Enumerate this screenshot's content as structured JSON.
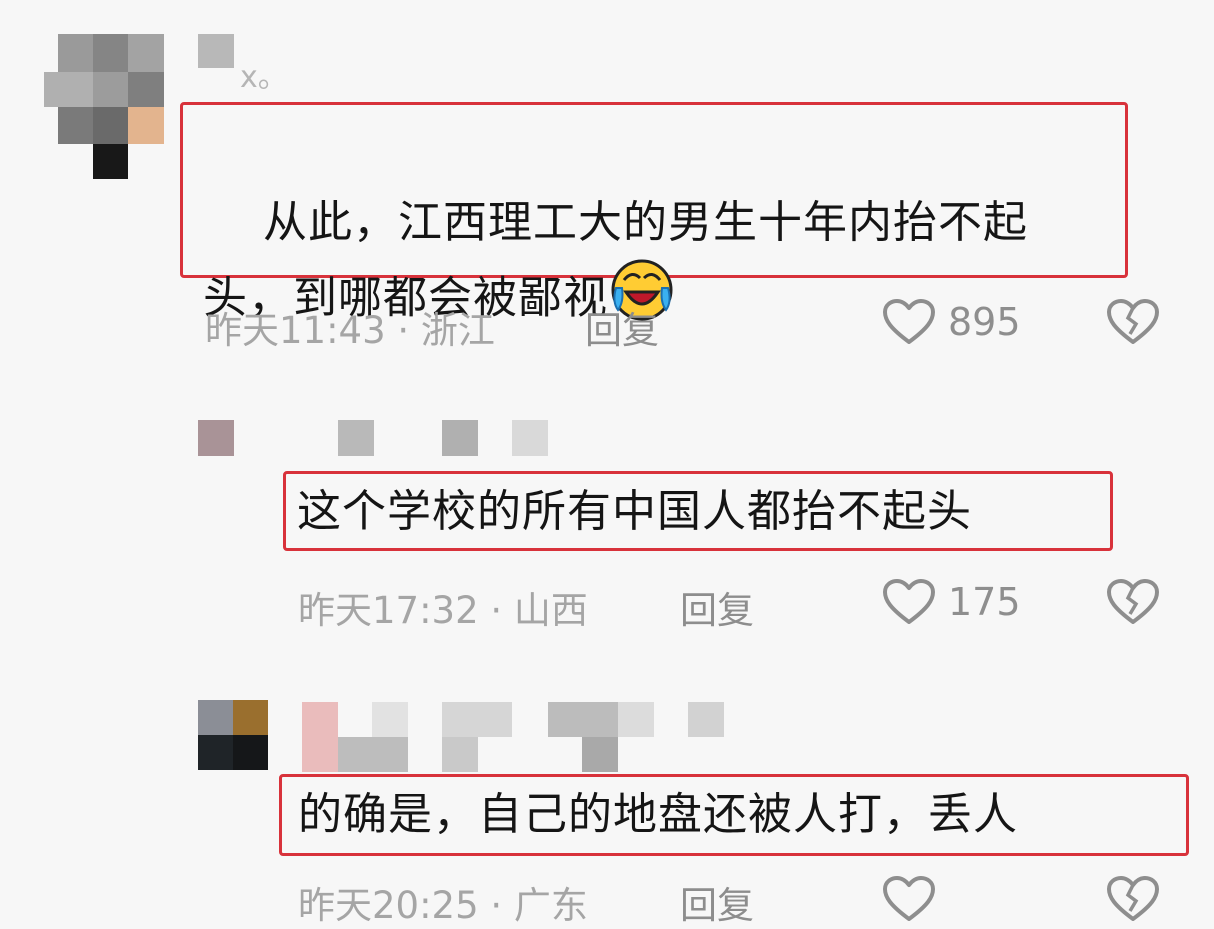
{
  "comments": [
    {
      "name_tail": "x。",
      "text": "从此，江西理工大的男生十年内抬不起头，到哪都会被鄙视",
      "emoji": "laughing-crying-face",
      "time": "昨天11:43 · 浙江",
      "reply": "回复",
      "likes": "895"
    },
    {
      "text": "这个学校的所有中国人都抬不起头",
      "time": "昨天17:32 · 山西",
      "reply": "回复",
      "likes": "175"
    },
    {
      "text": "的确是，自己的地盘还被人打，丢人",
      "time": "昨天20:25 · 广东",
      "reply": "回复"
    }
  ],
  "colors": {
    "highlight_border": "#d8323b",
    "meta_text": "#a5a5a5",
    "icon": "#8e8e8e"
  },
  "icons": [
    "heart-outline-icon",
    "broken-heart-icon",
    "laughing-crying-emoji"
  ]
}
